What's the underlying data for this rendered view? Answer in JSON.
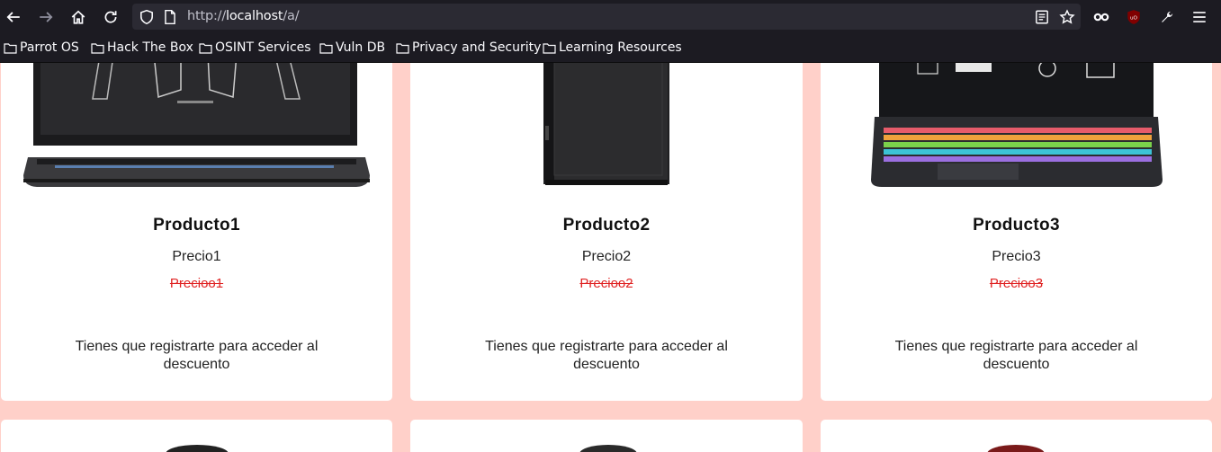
{
  "browser": {
    "url_prefix": "http://",
    "url_host": "localhost",
    "url_path": "/a/",
    "bookmarks": [
      {
        "label": "Parrot OS"
      },
      {
        "label": "Hack The Box"
      },
      {
        "label": "OSINT Services"
      },
      {
        "label": "Vuln DB"
      },
      {
        "label": "Privacy and Security"
      },
      {
        "label": "Learning Resources"
      }
    ]
  },
  "products": [
    {
      "name": "Producto1",
      "price": "Precio1",
      "old_price": "Precioo1",
      "note": "Tienes que registrarte para acceder al descuento",
      "image": "laptop"
    },
    {
      "name": "Producto2",
      "price": "Precio2",
      "old_price": "Precioo2",
      "note": "Tienes que registrarte para acceder al descuento",
      "image": "pc-tower"
    },
    {
      "name": "Producto3",
      "price": "Precio3",
      "old_price": "Precioo3",
      "note": "Tienes que registrarte para acceder al descuento",
      "image": "laptop-rgb"
    }
  ],
  "colors": {
    "page_bg": "#ffd0c9",
    "card_bg": "#ffffff",
    "strike_red": "#e02424",
    "chrome_bg": "#1c1b22"
  }
}
